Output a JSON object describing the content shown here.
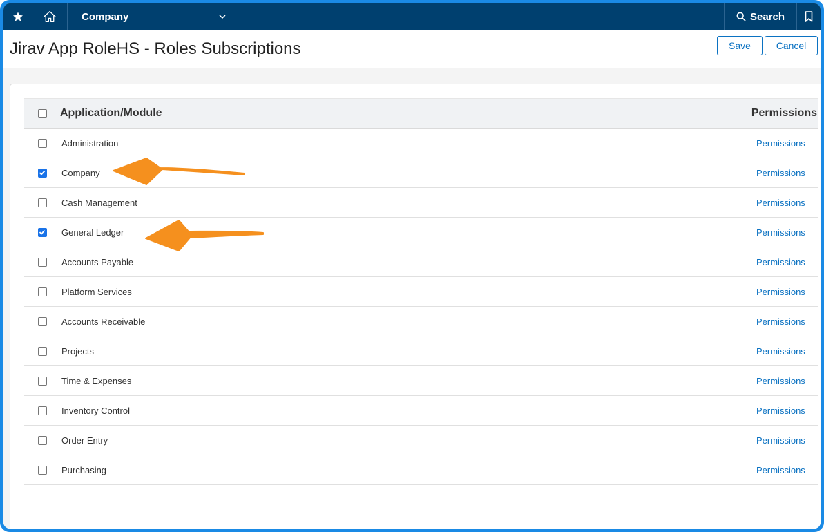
{
  "topbar": {
    "company_label": "Company",
    "search_label": "Search"
  },
  "page": {
    "title": "Jirav App RoleHS - Roles Subscriptions",
    "save_label": "Save",
    "cancel_label": "Cancel"
  },
  "table": {
    "header_app": "Application/Module",
    "header_perm": "Permissions",
    "header_checked": false,
    "rows": [
      {
        "name": "Administration",
        "checked": false,
        "perm": "Permissions"
      },
      {
        "name": "Company",
        "checked": true,
        "perm": "Permissions"
      },
      {
        "name": "Cash Management",
        "checked": false,
        "perm": "Permissions"
      },
      {
        "name": "General Ledger",
        "checked": true,
        "perm": "Permissions"
      },
      {
        "name": "Accounts Payable",
        "checked": false,
        "perm": "Permissions"
      },
      {
        "name": "Platform Services",
        "checked": false,
        "perm": "Permissions"
      },
      {
        "name": "Accounts Receivable",
        "checked": false,
        "perm": "Permissions"
      },
      {
        "name": "Projects",
        "checked": false,
        "perm": "Permissions"
      },
      {
        "name": "Time & Expenses",
        "checked": false,
        "perm": "Permissions"
      },
      {
        "name": "Inventory Control",
        "checked": false,
        "perm": "Permissions"
      },
      {
        "name": "Order Entry",
        "checked": false,
        "perm": "Permissions"
      },
      {
        "name": "Purchasing",
        "checked": false,
        "perm": "Permissions"
      }
    ]
  },
  "annotations": {
    "arrow_color": "#f5901e",
    "arrow_targets": [
      "Company",
      "General Ledger"
    ]
  },
  "colors": {
    "topbar_bg": "#00406f",
    "accent": "#0b72c2",
    "frame_border": "#1a8ae5"
  }
}
